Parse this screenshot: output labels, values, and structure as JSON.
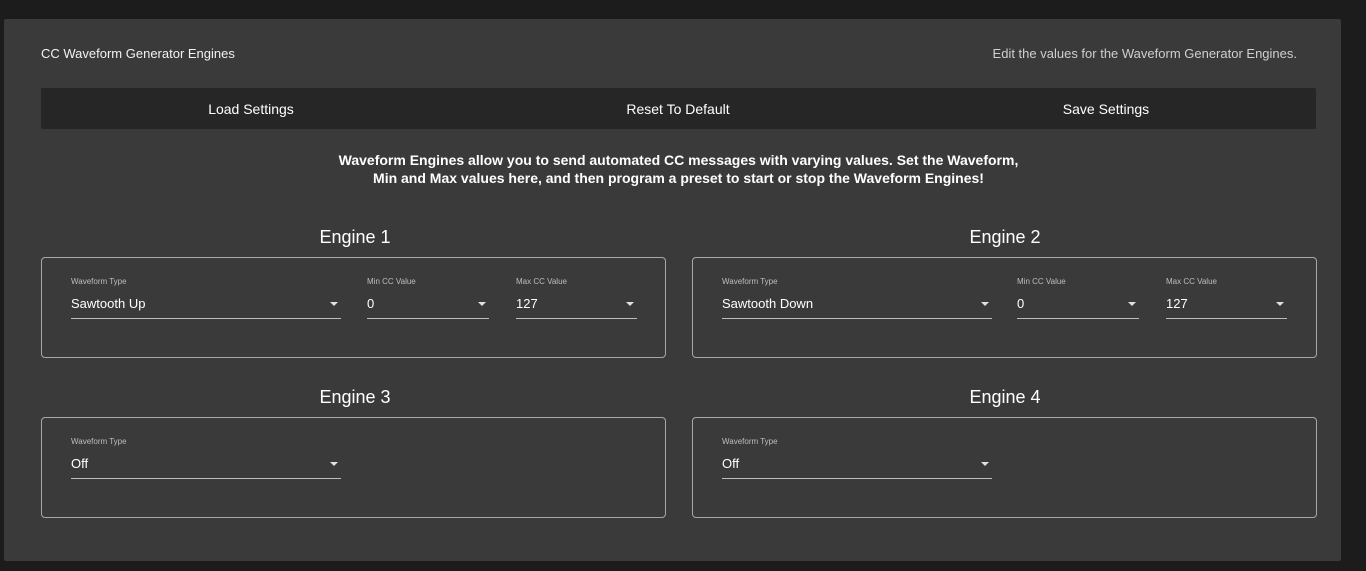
{
  "header": {
    "title": "CC Waveform Generator Engines",
    "subtitle": "Edit the values for the Waveform Generator Engines."
  },
  "toolbar": {
    "load_label": "Load Settings",
    "reset_label": "Reset To Default",
    "save_label": "Save Settings"
  },
  "description": {
    "line1": "Waveform Engines allow you to send automated CC messages with varying values. Set the Waveform,",
    "line2": "Min and Max values here, and then program a preset to start or stop the Waveform Engines!"
  },
  "engines": [
    {
      "title": "Engine 1",
      "waveform_label": "Waveform Type",
      "waveform_value": "Sawtooth Up",
      "min_label": "Min CC Value",
      "min_value": "0",
      "max_label": "Max CC Value",
      "max_value": "127"
    },
    {
      "title": "Engine 2",
      "waveform_label": "Waveform Type",
      "waveform_value": "Sawtooth Down",
      "min_label": "Min CC Value",
      "min_value": "0",
      "max_label": "Max CC Value",
      "max_value": "127"
    },
    {
      "title": "Engine 3",
      "waveform_label": "Waveform Type",
      "waveform_value": "Off"
    },
    {
      "title": "Engine 4",
      "waveform_label": "Waveform Type",
      "waveform_value": "Off"
    }
  ],
  "icons": {
    "dropdown": "chevron-down-icon"
  },
  "colors": {
    "panel_background": "#3a3a3a",
    "toolbar_background": "#262626",
    "page_background": "#1c1c1c"
  }
}
